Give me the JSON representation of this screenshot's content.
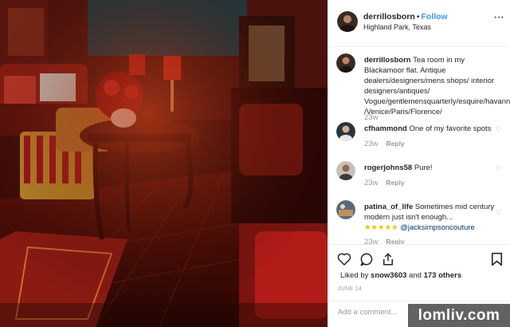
{
  "post": {
    "username": "derrillosborn",
    "follow_label": "Follow",
    "location": "Highland Park, Texas",
    "more_icon": "more-icon",
    "photo_description": "red antique-filled tea room"
  },
  "comments": [
    {
      "username": "derrillosborn",
      "text": "Tea room in my Blackamoor flat. Antique dealers/designers/mens shops/ interior designers/antiques/ Vogue/gentlemensquarterly/esquire/havanna /Venice/Paris/Florence/",
      "time": "23w"
    },
    {
      "username": "cfhammond",
      "text": "One of my favorite spots",
      "time": "23w",
      "reply_label": "Reply"
    },
    {
      "username": "rogerjohns58",
      "text": "Pure!",
      "time": "23w",
      "reply_label": "Reply"
    },
    {
      "username": "patina_of_life",
      "text": "Sometimes mid century modern just isn't enough...",
      "stars": "★★★★★",
      "mention": "@jacksimpsoncouture",
      "time": "23w",
      "reply_label": "Reply"
    }
  ],
  "actions": {
    "liked_by_prefix": "Liked by",
    "liked_by_user": "snow3603",
    "and_label": "and",
    "others_label": "173 others",
    "date": "JUNE 14",
    "add_comment_placeholder": "Add a comment..."
  },
  "watermark": "lomliv.com",
  "colors": {
    "link": "#3897f0",
    "text": "#262626",
    "muted": "#999999",
    "border": "#efefef"
  }
}
